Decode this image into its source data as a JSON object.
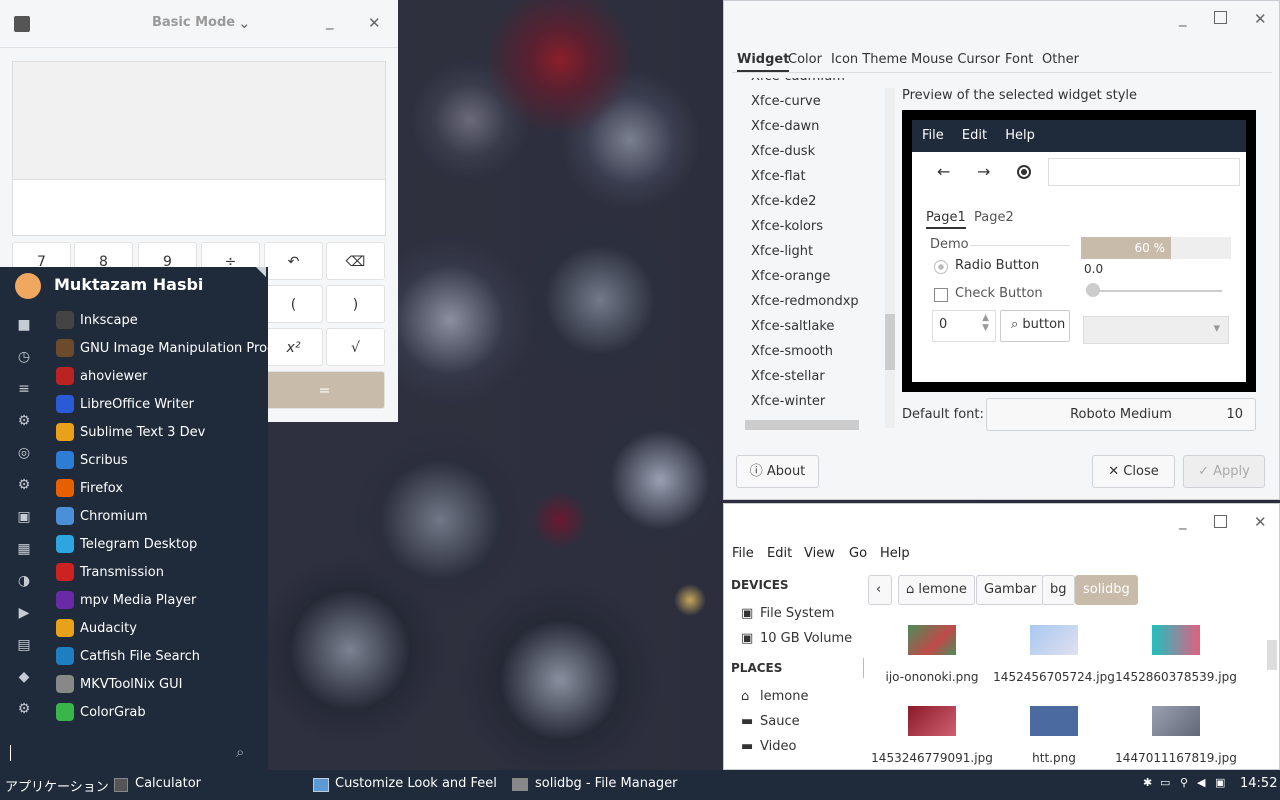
{
  "calculator": {
    "title": "Basic Mode",
    "keys_row1": [
      "7",
      "8",
      "9",
      "÷",
      "↶",
      "⌫"
    ],
    "keys_row2": [
      "(",
      ")"
    ],
    "keys_row3": [
      "x²",
      "√"
    ],
    "equals": "="
  },
  "menu": {
    "user": "Muktazam Hasbi",
    "items": [
      "Inkscape",
      "GNU Image Manipulation Prog...",
      "ahoviewer",
      "LibreOffice Writer",
      "Sublime Text 3 Dev",
      "Scribus",
      "Firefox",
      "Chromium",
      "Telegram Desktop",
      "Transmission",
      "mpv Media Player",
      "Audacity",
      "Catfish File Search",
      "MKVToolNix GUI",
      "ColorGrab"
    ],
    "item_colors": [
      "#444",
      "#6b4b2a",
      "#b22",
      "#2a5bd7",
      "#e7a11a",
      "#2d7cd6",
      "#e66000",
      "#4a90d9",
      "#2ca5e0",
      "#c22",
      "#6a2aa8",
      "#e8a11a",
      "#1d7fc1",
      "#888",
      "#3ab54a"
    ]
  },
  "appearance": {
    "tabs": [
      "Widget",
      "Color",
      "Icon Theme",
      "Mouse Cursor",
      "Font",
      "Other"
    ],
    "themes": [
      "Xfce-cadmium",
      "Xfce-curve",
      "Xfce-dawn",
      "Xfce-dusk",
      "Xfce-flat",
      "Xfce-kde2",
      "Xfce-kolors",
      "Xfce-light",
      "Xfce-orange",
      "Xfce-redmondxp",
      "Xfce-saltlake",
      "Xfce-smooth",
      "Xfce-stellar",
      "Xfce-winter"
    ],
    "preview_label": "Preview of the selected widget style",
    "preview": {
      "menu": [
        "File",
        "Edit",
        "Help"
      ],
      "pages": [
        "Page1",
        "Page2"
      ],
      "demo": "Demo",
      "radio": "Radio Button",
      "check": "Check Button",
      "spin": "0",
      "button": "button",
      "progress": "60 %",
      "progress_value": 0.6,
      "slider": "0.0"
    },
    "default_font_label": "Default font:",
    "font_name": "Roboto Medium",
    "font_size": "10",
    "about": "About",
    "close": "Close",
    "apply": "Apply"
  },
  "filemanager": {
    "menu": [
      "File",
      "Edit",
      "View",
      "Go",
      "Help"
    ],
    "devices_h": "DEVICES",
    "devices": [
      "File System",
      "10 GB Volume"
    ],
    "places_h": "PLACES",
    "places": [
      "lemone",
      "Sauce",
      "Video"
    ],
    "crumbs": [
      "lemone",
      "Gambar",
      "bg",
      "solidbg"
    ],
    "files": [
      "ijo-ononoki.png",
      "1452456705724.jpg",
      "1452860378539.jpg",
      "1453246779091.jpg",
      "htt.png",
      "1447011167819.jpg"
    ]
  },
  "taskbar": {
    "apps": "アプリケーション",
    "tasks": [
      "Calculator",
      "Customize Look and Feel",
      "solidbg - File Manager"
    ],
    "clock": "14:52"
  }
}
